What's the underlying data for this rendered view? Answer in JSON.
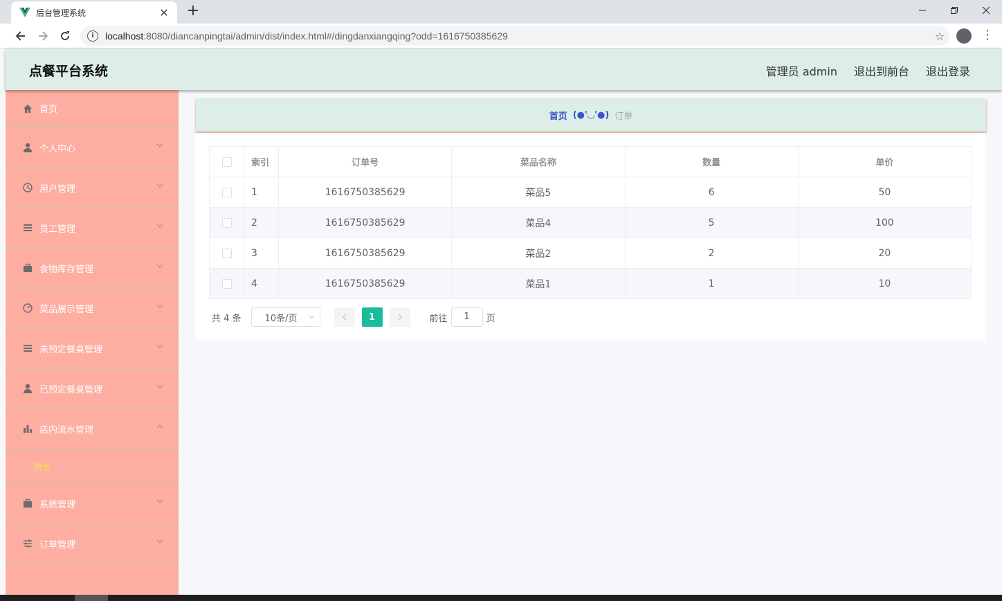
{
  "browser": {
    "tab_title": "后台管理系统",
    "tab_close": "✕",
    "new_tab": "+",
    "url_host": "localhost",
    "url_rest": ":8080/diancanpingtai/admin/dist/index.html#/dingdanxiangqing?odd=1616750385629"
  },
  "header": {
    "title": "点餐平台系统",
    "user": "管理员 admin",
    "to_front": "退出到前台",
    "logout": "退出登录"
  },
  "sidebar": {
    "items": [
      {
        "label": "首页",
        "icon": "home-icon"
      },
      {
        "label": "个人中心",
        "icon": "user-icon"
      },
      {
        "label": "用户管理",
        "icon": "clock-icon"
      },
      {
        "label": "员工管理",
        "icon": "list-icon"
      },
      {
        "label": "食物库存管理",
        "icon": "briefcase-icon"
      },
      {
        "label": "菜品展示管理",
        "icon": "gauge-icon"
      },
      {
        "label": "未预定餐桌管理",
        "icon": "list-icon"
      },
      {
        "label": "已预定餐桌管理",
        "icon": "user-icon"
      },
      {
        "label": "店内流水管理",
        "icon": "bar-chart-icon"
      },
      {
        "label": "系统管理",
        "icon": "briefcase-icon"
      },
      {
        "label": "订单管理",
        "icon": "sliders-icon"
      }
    ],
    "submenu_label": "流水"
  },
  "breadcrumb": {
    "home": "首页",
    "separator": "(●'◡'●)",
    "current": "订单"
  },
  "table": {
    "headers": [
      "索引",
      "订单号",
      "菜品名称",
      "数量",
      "单价"
    ],
    "rows": [
      [
        "1",
        "1616750385629",
        "菜品5",
        "6",
        "50"
      ],
      [
        "2",
        "1616750385629",
        "菜品4",
        "5",
        "100"
      ],
      [
        "3",
        "1616750385629",
        "菜品2",
        "2",
        "20"
      ],
      [
        "4",
        "1616750385629",
        "菜品1",
        "1",
        "10"
      ]
    ]
  },
  "pager": {
    "total": "共 4 条",
    "page_size": "10条/页",
    "current_page": "1",
    "goto_prefix": "前往",
    "goto_value": "1",
    "goto_suffix": "页"
  },
  "colors": {
    "header_bg": "#ddeee8",
    "sidebar_bg": "#fdaea1",
    "submenu_text": "#f6e443",
    "accent": "#1abc9c"
  }
}
